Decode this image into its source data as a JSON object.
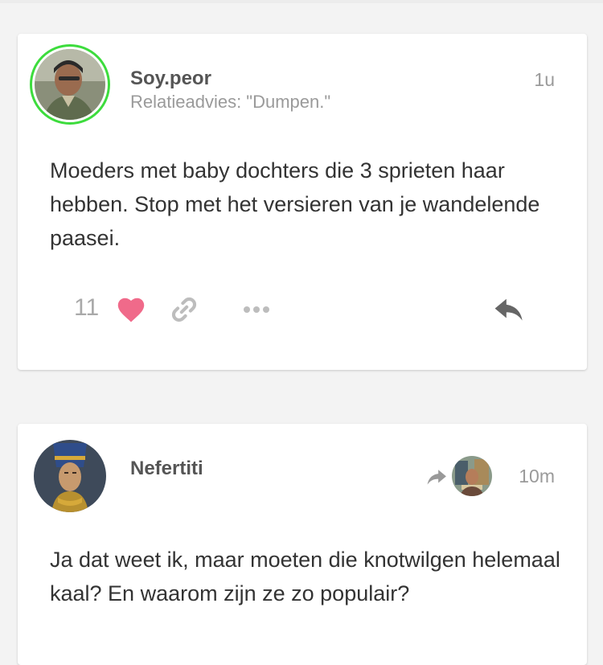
{
  "posts": [
    {
      "username": "Soy.peor",
      "subtitle": "Relatieadvies: \"Dumpen.\"",
      "time": "1u",
      "body": "Moeders met baby dochters die 3 sprieten haar hebben. Stop met het versieren van je wandelende paasei.",
      "like_count": "11",
      "avatar_ring_color": "#3ddc3d"
    },
    {
      "username": "Nefertiti",
      "time": "10m",
      "body": "Ja dat weet ik, maar moeten die knotwilgen helemaal kaal? En waarom zijn ze zo populair?"
    }
  ],
  "icons": {
    "like": "heart-icon",
    "share": "link-icon",
    "more": "more-icon",
    "reply": "reply-icon",
    "reply_indicator": "share-arrow-icon"
  },
  "colors": {
    "heart": "#f06a8a",
    "icon_gray": "#bdbdbd",
    "reply_gray": "#666666"
  }
}
